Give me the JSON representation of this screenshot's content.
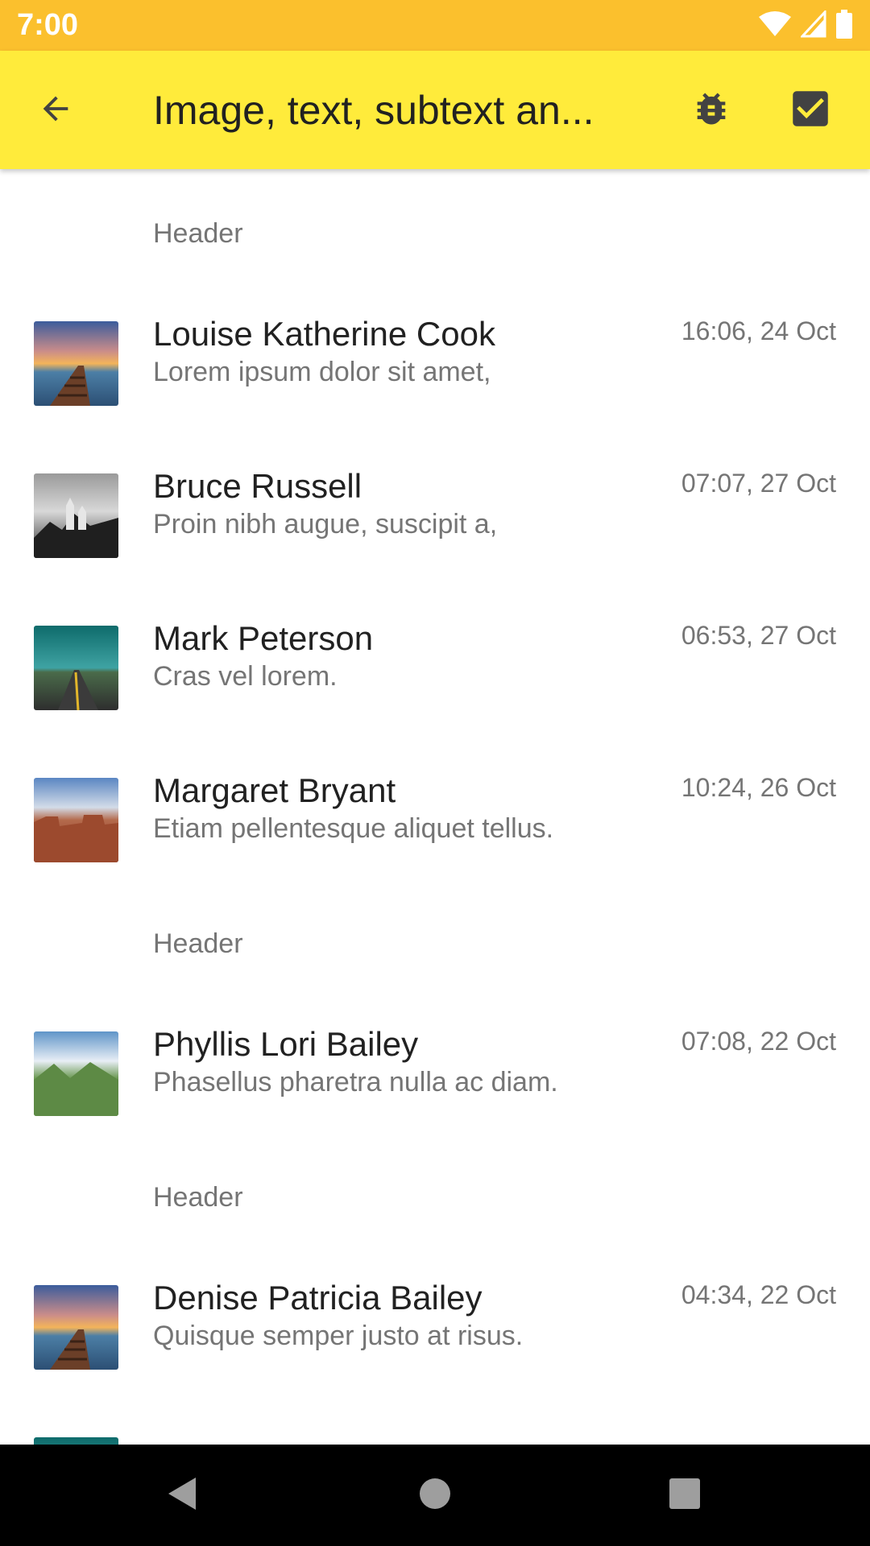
{
  "status_bar": {
    "time": "7:00",
    "icons": [
      "wifi-icon",
      "signal-icon",
      "battery-icon"
    ],
    "color": "#FBC02D"
  },
  "app_bar": {
    "title": "Image, text, subtext an...",
    "color": "#FFEB3B",
    "icons": [
      "back-arrow-icon",
      "bug-icon",
      "checkbox-checked-icon"
    ]
  },
  "list": {
    "header_label": "Header",
    "sections": [
      {
        "header": "Header",
        "items": [
          {
            "title": "Louise Katherine Cook",
            "subtitle": "Lorem ipsum dolor sit amet,",
            "time": "16:06, 24 Oct",
            "image": "pier-sunset"
          },
          {
            "title": "Bruce Russell",
            "subtitle": "Proin nibh augue, suscipit a,",
            "time": "07:07, 27 Oct",
            "image": "castle-bw"
          },
          {
            "title": "Mark Peterson",
            "subtitle": "Cras vel lorem.",
            "time": "06:53, 27 Oct",
            "image": "road-teal"
          },
          {
            "title": "Margaret Bryant",
            "subtitle": "Etiam pellentesque aliquet tellus.",
            "time": "10:24, 26 Oct",
            "image": "canyon-desert"
          }
        ]
      },
      {
        "header": "Header",
        "items": [
          {
            "title": "Phyllis Lori Bailey",
            "subtitle": "Phasellus pharetra nulla ac diam.",
            "time": "07:08, 22 Oct",
            "image": "green-valley"
          }
        ]
      },
      {
        "header": "Header",
        "items": [
          {
            "title": "Denise Patricia Bailey",
            "subtitle": "Quisque semper justo at risus.",
            "time": "04:34, 22 Oct",
            "image": "pier-sunset"
          }
        ]
      }
    ]
  },
  "nav_bar": {
    "icons": [
      "nav-back-icon",
      "nav-home-icon",
      "nav-recents-icon"
    ]
  }
}
